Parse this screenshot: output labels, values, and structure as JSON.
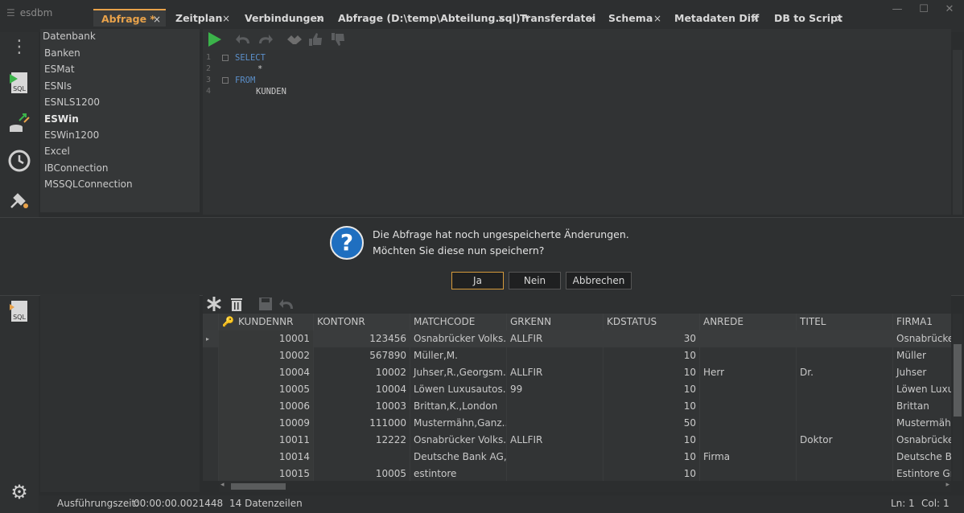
{
  "app": {
    "title": "esdbm"
  },
  "tabs": [
    {
      "label": "Abfrage *",
      "active": true
    },
    {
      "label": "Zeitplan"
    },
    {
      "label": "Verbindungen"
    },
    {
      "label": "Abfrage (D:\\temp\\Abteilung.sql) *"
    },
    {
      "label": "Transferdatei"
    },
    {
      "label": "Schema"
    },
    {
      "label": "Metadaten Diff"
    },
    {
      "label": "DB to Script"
    }
  ],
  "tab_close_glyph": "×",
  "window_controls": {
    "minimize": "—",
    "maximize": "☐",
    "close": "✕"
  },
  "rail_icons": {
    "menu": "⋮",
    "sql": "SQL",
    "transfer": "⇄",
    "clock": "🕘",
    "plug": "⚡",
    "settings": "⚙",
    "sql2": "SQL"
  },
  "db_panel": {
    "header": "Datenbank",
    "items": [
      "Banken",
      "ESMat",
      "ESNIs",
      "ESNLS1200",
      "ESWin",
      "ESWin1200",
      "Excel",
      "IBConnection",
      "MSSQLConnection"
    ],
    "bold_item": "ESWin"
  },
  "editor": {
    "lines": [
      {
        "n": "1",
        "kw": "SELECT",
        "code": ""
      },
      {
        "n": "2",
        "kw": "",
        "code": "*"
      },
      {
        "n": "3",
        "kw": "FROM",
        "code": ""
      },
      {
        "n": "4",
        "kw": "",
        "code": "KUNDEN"
      }
    ]
  },
  "dialog": {
    "icon": "?",
    "line1": "Die Abfrage hat noch ungespeicherte Änderungen.",
    "line2": "Möchten Sie diese nun speichern?",
    "btn_yes": "Ja",
    "btn_no": "Nein",
    "btn_cancel": "Abbrechen"
  },
  "grid": {
    "columns": [
      "KUNDENNR",
      "KONTONR",
      "MATCHCODE",
      "GRKENN",
      "KDSTATUS",
      "ANREDE",
      "TITEL",
      "FIRMA1"
    ],
    "rows": [
      [
        "10001",
        "123456",
        "Osnabrücker Volks...",
        "ALLFIR",
        "30",
        "",
        "",
        "Osnabrücke"
      ],
      [
        "10002",
        "567890",
        "Müller,M.",
        "",
        "10",
        "",
        "",
        "Müller"
      ],
      [
        "10004",
        "10002",
        "Juhser,R.,Georgsm...",
        "ALLFIR",
        "10",
        "Herr",
        "Dr.",
        "Juhser"
      ],
      [
        "10005",
        "10004",
        "Löwen Luxusautos...",
        "99",
        "10",
        "",
        "",
        "Löwen Luxus"
      ],
      [
        "10006",
        "10003",
        "Brittan,K.,London",
        "",
        "10",
        "",
        "",
        "Brittan"
      ],
      [
        "10009",
        "111000",
        "Mustermähn,Ganz...",
        "",
        "50",
        "",
        "",
        "Mustermähn"
      ],
      [
        "10011",
        "12222",
        "Osnabrücker Volks...",
        "ALLFIR",
        "10",
        "",
        "Doktor",
        "Osnabrücke"
      ],
      [
        "10014",
        "",
        "Deutsche Bank AG,...",
        "",
        "10",
        "Firma",
        "",
        "Deutsche Ba"
      ],
      [
        "10015",
        "10005",
        "estintore",
        "",
        "10",
        "",
        "",
        "Estintore Gn"
      ]
    ]
  },
  "status": {
    "exec_label": "Ausführungszeit:",
    "exec_value": "00:00:00.0021448",
    "rows": "14 Datenzeilen",
    "ln_label": "Ln:",
    "ln_value": "1",
    "col_label": "Col:",
    "col_value": "1"
  }
}
